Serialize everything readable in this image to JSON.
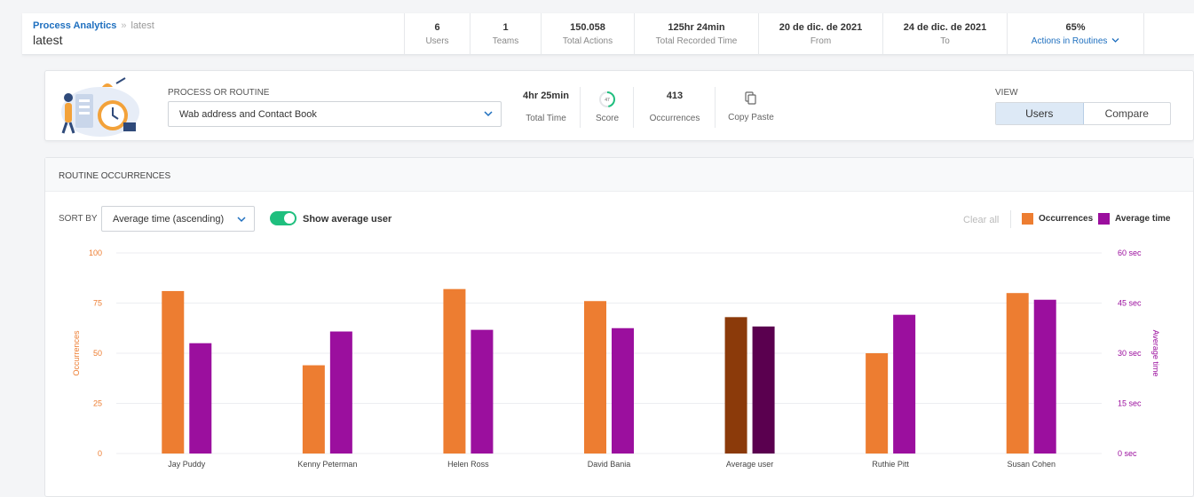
{
  "header": {
    "breadcrumb_link": "Process Analytics",
    "breadcrumb_sep": "»",
    "breadcrumb_current": "latest",
    "title": "latest",
    "stats": [
      {
        "value": "6",
        "label": "Users"
      },
      {
        "value": "1",
        "label": "Teams"
      },
      {
        "value": "150.058",
        "label": "Total Actions"
      },
      {
        "value": "125hr 24min",
        "label": "Total Recorded Time"
      },
      {
        "value": "20 de dic. de 2021",
        "label": "From"
      },
      {
        "value": "24 de dic. de 2021",
        "label": "To"
      },
      {
        "value": "65%",
        "label": "Actions in Routines"
      }
    ]
  },
  "routine": {
    "label": "PROCESS OR ROUTINE",
    "selected": "Wab address and Contact Book",
    "total_time_value": "4hr 25min",
    "total_time_label": "Total Time",
    "score_value": "47",
    "score_fraction": 0.47,
    "score_label": "Score",
    "occurrences_value": "413",
    "occurrences_label": "Occurrences",
    "copy_paste_label": "Copy Paste",
    "view_label": "VIEW",
    "view_options": [
      "Users",
      "Compare"
    ],
    "view_selected": "Users"
  },
  "chart_section": {
    "title": "ROUTINE OCCURRENCES",
    "sort_label": "SORT BY",
    "sort_selected": "Average time (ascending)",
    "toggle_label": "Show average user",
    "toggle_on": true,
    "clear_all": "Clear all",
    "colors": {
      "occurrences": "#ed7d31",
      "average_time": "#9b0f9e",
      "occurrences_highlight": "#8b3a0a",
      "average_time_highlight": "#5a004f"
    }
  },
  "chart_data": {
    "type": "bar",
    "categories": [
      "Jay Puddy",
      "Kenny Peterman",
      "Helen Ross",
      "David Bania",
      "Average user",
      "Ruthie Pitt",
      "Susan Cohen"
    ],
    "highlight_category": "Average user",
    "series": [
      {
        "name": "Occurrences",
        "axis": "left",
        "values": [
          81,
          44,
          82,
          76,
          68,
          50,
          80
        ]
      },
      {
        "name": "Average time",
        "axis": "right",
        "values": [
          33,
          36.5,
          37,
          37.5,
          38,
          41.5,
          46
        ]
      }
    ],
    "ylabel_left": "Occurrences",
    "ylabel_right": "Average time",
    "ylim_left": [
      0,
      100
    ],
    "ylim_right": [
      0,
      60
    ],
    "yticks_left": [
      "0",
      "25",
      "50",
      "75",
      "100"
    ],
    "yticks_right": [
      "0 sec",
      "15 sec",
      "30 sec",
      "45 sec",
      "60 sec"
    ],
    "legend_placement": "top-right",
    "grid": true
  }
}
